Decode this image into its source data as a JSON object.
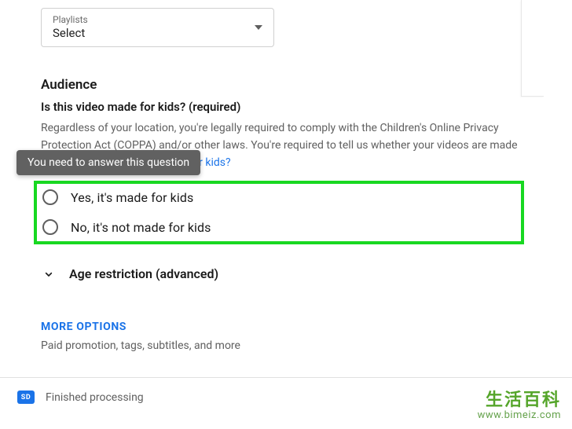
{
  "playlists": {
    "label": "Playlists",
    "value": "Select"
  },
  "audience": {
    "title": "Audience",
    "required_line": "Is this video made for kids? (required)",
    "description_part1": "Regardless of your location, you're legally required to comply with the Children's Online Privacy Protection Act (COPPA) and/or other laws. You're required to tell us whether your videos are made for kids. ",
    "link_text": "What's content made for kids?",
    "tooltip": "You need to answer this question",
    "option_yes": "Yes, it's made for kids",
    "option_no": "No, it's not made for kids",
    "age_restriction_label": "Age restriction (advanced)"
  },
  "more_options": {
    "label": "MORE OPTIONS",
    "desc": "Paid promotion, tags, subtitles, and more"
  },
  "status": {
    "badge": "SD",
    "text": "Finished processing"
  },
  "watermark": {
    "top": "生活百科",
    "bottom": "www.bimeiz.com"
  }
}
